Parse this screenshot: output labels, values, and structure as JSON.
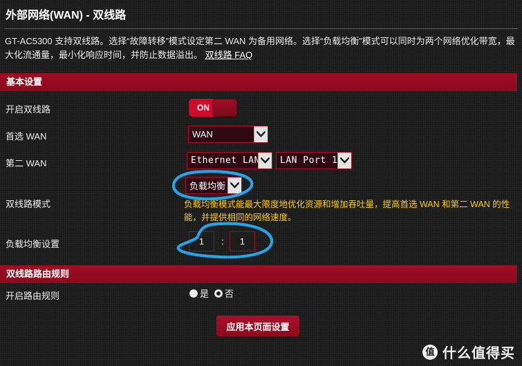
{
  "header": {
    "title": "外部网络(WAN) - 双线路",
    "description_before_link": "GT-AC5300 支持双线路。选择“故障转移”模式设定第二 WAN 为备用网络。选择“负载均衡”模式可以同时为两个网络优化带宽，最大化流通量，最小化响应时间，并防止数据溢出。 ",
    "faq_link": "双线路 FAQ"
  },
  "sections": {
    "basic_settings": "基本设置",
    "routing_rules": "双线路路由规则"
  },
  "basic": {
    "enable_dual_wan_label": "开启双线路",
    "toggle_state": "ON",
    "primary_wan_label": "首选 WAN",
    "primary_wan_value": "WAN",
    "second_wan_label": "第二 WAN",
    "second_wan_value": "Ethernet LAN",
    "lan_port_value": "LAN Port 1",
    "dual_wan_mode_label": "双线路模式",
    "dual_wan_mode_value": "负载均衡",
    "dual_wan_mode_desc": "负载均衡模式能最大限度地优化资源和增加吞吐量，提高首选 WAN 和第二 WAN 的性能，并提供相同的网络速度。",
    "load_balance_label": "负载均衡设置",
    "ratio_first": "1",
    "ratio_separator": ":",
    "ratio_second": "1"
  },
  "routing": {
    "enable_rules_label": "开启路由规则",
    "option_yes": "是",
    "option_no": "否",
    "selected": "否"
  },
  "footer": {
    "apply_button": "应用本页面设置"
  },
  "watermark": {
    "logo_char": "值",
    "text": "什么值得买"
  },
  "colors": {
    "accent_red": "#9e0c22",
    "toggle_on": "#cf0a2c",
    "description_yellow": "#ffcc00",
    "annotation_blue": "#29a3e8",
    "background": "#1b1b1b"
  },
  "icons": {
    "dropdown_arrow": "chevron-down-icon"
  }
}
